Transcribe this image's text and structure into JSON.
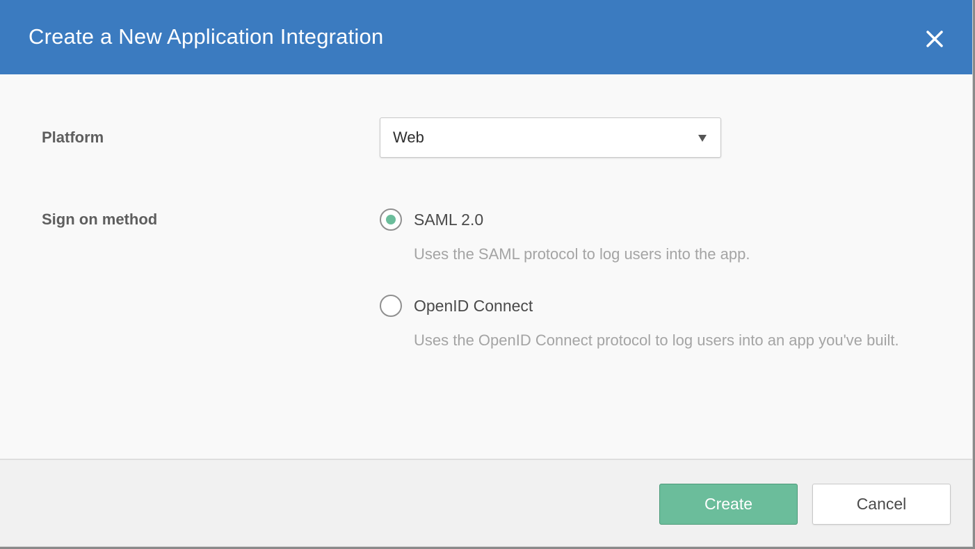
{
  "dialog": {
    "title": "Create a New Application Integration",
    "close_icon": "close-icon"
  },
  "form": {
    "platform": {
      "label": "Platform",
      "selected_value": "Web",
      "dropdown_icon": "chevron-down-icon"
    },
    "sign_on_method": {
      "label": "Sign on method",
      "options": [
        {
          "label": "SAML 2.0",
          "description": "Uses the SAML protocol to log users into the app.",
          "selected": true
        },
        {
          "label": "OpenID Connect",
          "description": "Uses the OpenID Connect protocol to log users into an app you've built.",
          "selected": false
        }
      ]
    }
  },
  "footer": {
    "create_label": "Create",
    "cancel_label": "Cancel"
  },
  "colors": {
    "header_bg": "#3b7bc0",
    "accent_green": "#6bbd9b",
    "body_bg": "#f9f9f9",
    "footer_bg": "#f1f1f1"
  }
}
